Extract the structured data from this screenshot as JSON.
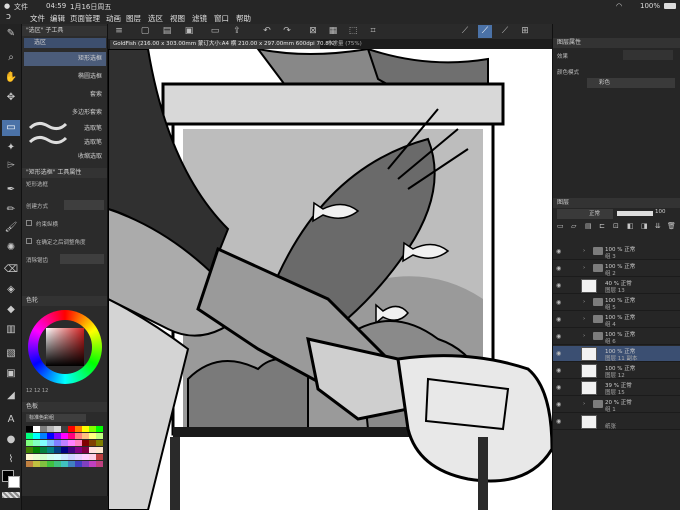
{
  "status_bar": {
    "app_menu": "文件",
    "time": "04:59",
    "date": "1月16日周五",
    "battery": "100%"
  },
  "menu_bar": {
    "items": [
      "文件",
      "编辑",
      "页面管理",
      "动画",
      "图层",
      "选区",
      "视图",
      "滤镜",
      "窗口",
      "帮助"
    ]
  },
  "tool_icons": [
    "hand-icon",
    "zoom-icon",
    "move-icon",
    "selection-icon",
    "lasso-icon",
    "eyedropper-icon",
    "pen-icon",
    "pencil-icon",
    "brush-icon",
    "airbrush-icon",
    "eraser-icon",
    "fill-icon",
    "gradient-icon",
    "shape-icon",
    "text-icon",
    "ruler-icon",
    "blend-icon"
  ],
  "subtool_panel": {
    "title": "\"选区\" 子工具",
    "group_label": "选区",
    "items": [
      "矩形选框",
      "椭圆选框",
      "套索",
      "多边形套索",
      "选取笔",
      "选取笔",
      "收缩选取"
    ],
    "selected_index": 0
  },
  "tool_property": {
    "title": "\"矩形选框\" 工具属性",
    "subtitle": "矩形选框",
    "rows": [
      "创建方式",
      "约束纵横",
      "在确定之后调整角度",
      "消除锯齿"
    ]
  },
  "color_panel": {
    "title": "色轮",
    "mode_labels": [
      "HSV"
    ],
    "readout": "12  12  12"
  },
  "palette_panel": {
    "title": "色板",
    "set_name": "标准色彩组",
    "swatches": [
      "#000000",
      "#ffffff",
      "#7f7f7f",
      "#b4b4b4",
      "#d8d8d8",
      "#404040",
      "#ff0000",
      "#ff8000",
      "#ffff00",
      "#80ff00",
      "#00ff00",
      "#00ff80",
      "#00ffff",
      "#0080ff",
      "#0000ff",
      "#8000ff",
      "#ff00ff",
      "#ff0080",
      "#ff8080",
      "#ffc080",
      "#ffff80",
      "#c0ff80",
      "#80ff80",
      "#80ffc0",
      "#80ffff",
      "#80c0ff",
      "#8080ff",
      "#c080ff",
      "#ff80ff",
      "#ff80c0",
      "#800000",
      "#804000",
      "#808000",
      "#408000",
      "#008000",
      "#008040",
      "#008080",
      "#004080",
      "#000080",
      "#400080",
      "#800080",
      "#800040",
      "#ffe0e0",
      "#ffe8d0",
      "#fff8d0",
      "#e8ffd0",
      "#d0ffd0",
      "#d0fff0",
      "#d0ffff",
      "#d0e8ff",
      "#d0d0ff",
      "#e8d0ff",
      "#ffd0ff",
      "#ffd0e8",
      "#c04040",
      "#c08040",
      "#c0c040",
      "#80c040",
      "#40c040",
      "#40c080",
      "#40c0c0",
      "#4080c0",
      "#4040c0",
      "#8040c0",
      "#c040c0",
      "#c04080"
    ]
  },
  "document_tabs": [
    {
      "label": "GoldFish (216.00 x 303.00mm 蒙订大小:A4 横 210.00 x 297.00mm 600dpi 70.8%)",
      "active": true
    },
    {
      "label": "非常量 (75%)",
      "active": false
    }
  ],
  "navigator": {
    "title": "图层属性",
    "effect_label": "效果",
    "blend_label": "颜色模式",
    "color_mode_value": "彩色"
  },
  "layer_panel": {
    "title": "图层",
    "blend_mode": "正常",
    "opacity": "100",
    "layers": [
      {
        "percent": "100 %  正常",
        "name": "组 3",
        "type": "folder",
        "selected": false
      },
      {
        "percent": "100 %  正常",
        "name": "组 2",
        "type": "folder",
        "selected": false
      },
      {
        "percent": "40 %  正常",
        "name": "图层 13",
        "type": "raster",
        "selected": false
      },
      {
        "percent": "100 %  正常",
        "name": "组 5",
        "type": "folder",
        "selected": false
      },
      {
        "percent": "100 %  正常",
        "name": "组 4",
        "type": "folder",
        "selected": false
      },
      {
        "percent": "100 %  正常",
        "name": "组 6",
        "type": "folder",
        "selected": false
      },
      {
        "percent": "100 %  正常",
        "name": "图层 11 副本",
        "type": "raster",
        "selected": true
      },
      {
        "percent": "100 %  正常",
        "name": "图层 12",
        "type": "raster",
        "selected": false
      },
      {
        "percent": "39 %  正常",
        "name": "图层 15",
        "type": "raster",
        "selected": false
      },
      {
        "percent": "20 %  正常",
        "name": "组 1",
        "type": "folder",
        "selected": false
      },
      {
        "percent": "",
        "name": "纸张",
        "type": "paper",
        "selected": false
      }
    ]
  }
}
